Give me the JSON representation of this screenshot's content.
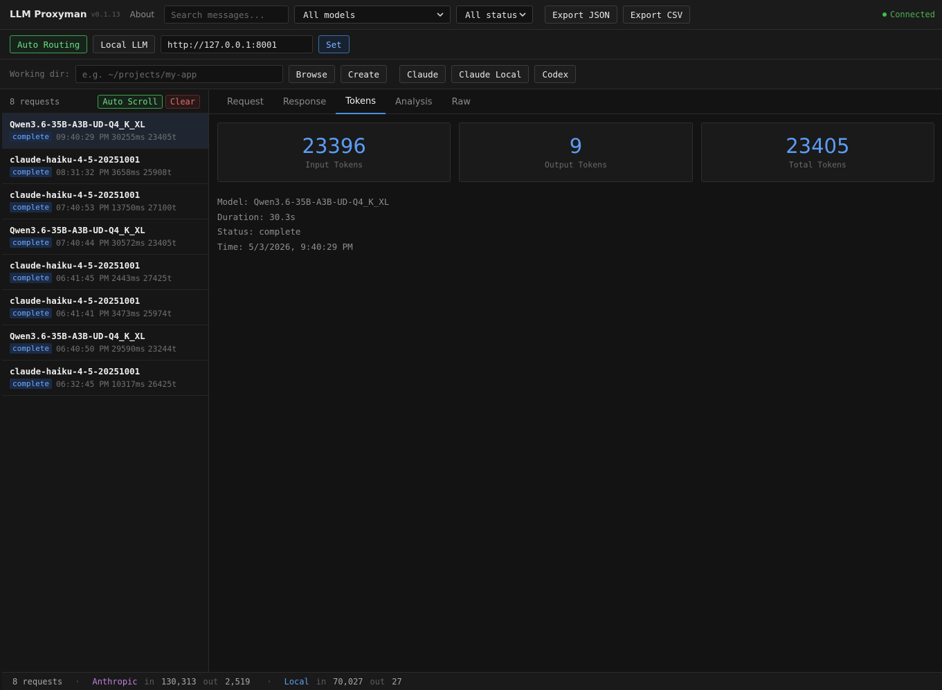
{
  "header": {
    "title": "LLM Proxyman",
    "version": "v0.1.13",
    "about": "About",
    "search_placeholder": "Search messages...",
    "model_filter": "All models",
    "status_filter": "All status",
    "export_json": "Export JSON",
    "export_csv": "Export CSV",
    "connection": "Connected"
  },
  "routing": {
    "auto_routing": "Auto Routing",
    "local_llm": "Local LLM",
    "url": "http://127.0.0.1:8001",
    "set": "Set"
  },
  "workdir": {
    "label": "Working dir:",
    "placeholder": "e.g. ~/projects/my-app",
    "browse": "Browse",
    "create": "Create",
    "claude": "Claude",
    "claude_local": "Claude Local",
    "codex": "Codex"
  },
  "sidebar": {
    "count": "8 requests",
    "auto_scroll": "Auto Scroll",
    "clear": "Clear",
    "items": [
      {
        "model": "Qwen3.6-35B-A3B-UD-Q4_K_XL",
        "status": "complete",
        "time": "09:40:29 PM",
        "duration": "30255ms",
        "tokens": "23405t"
      },
      {
        "model": "claude-haiku-4-5-20251001",
        "status": "complete",
        "time": "08:31:32 PM",
        "duration": "3658ms",
        "tokens": "25908t"
      },
      {
        "model": "claude-haiku-4-5-20251001",
        "status": "complete",
        "time": "07:40:53 PM",
        "duration": "13750ms",
        "tokens": "27100t"
      },
      {
        "model": "Qwen3.6-35B-A3B-UD-Q4_K_XL",
        "status": "complete",
        "time": "07:40:44 PM",
        "duration": "30572ms",
        "tokens": "23405t"
      },
      {
        "model": "claude-haiku-4-5-20251001",
        "status": "complete",
        "time": "06:41:45 PM",
        "duration": "2443ms",
        "tokens": "27425t"
      },
      {
        "model": "claude-haiku-4-5-20251001",
        "status": "complete",
        "time": "06:41:41 PM",
        "duration": "3473ms",
        "tokens": "25974t"
      },
      {
        "model": "Qwen3.6-35B-A3B-UD-Q4_K_XL",
        "status": "complete",
        "time": "06:40:50 PM",
        "duration": "29590ms",
        "tokens": "23244t"
      },
      {
        "model": "claude-haiku-4-5-20251001",
        "status": "complete",
        "time": "06:32:45 PM",
        "duration": "10317ms",
        "tokens": "26425t"
      }
    ]
  },
  "tabs": [
    "Request",
    "Response",
    "Tokens",
    "Analysis",
    "Raw"
  ],
  "tokens": {
    "input": {
      "value": "23396",
      "label": "Input Tokens"
    },
    "output": {
      "value": "9",
      "label": "Output Tokens"
    },
    "total": {
      "value": "23405",
      "label": "Total Tokens"
    }
  },
  "details": {
    "model": "Model: Qwen3.6-35B-A3B-UD-Q4_K_XL",
    "duration": "Duration: 30.3s",
    "status": "Status: complete",
    "time": "Time: 5/3/2026, 9:40:29 PM"
  },
  "footer": {
    "count": "8 requests",
    "sep": "·",
    "anthropic": "Anthropic",
    "local": "Local",
    "in": "in",
    "out": "out",
    "anth_in": "130,313",
    "anth_out": "2,519",
    "local_in": "70,027",
    "local_out": "27"
  }
}
